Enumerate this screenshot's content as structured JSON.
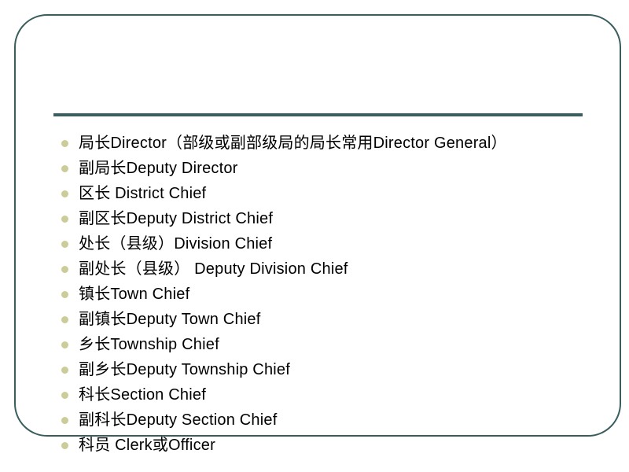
{
  "slide": {
    "title": "",
    "frame": {
      "border_color": "#3a5d5d",
      "corner_radius_px": 42
    },
    "divider": {
      "color": "#3d5e5e"
    },
    "bullet": {
      "marker_icon": "disc-bullet-icon",
      "marker_color": "#cccc99"
    },
    "text_color": "#000000",
    "background_color": "#ffffff"
  },
  "body": {
    "items": [
      {
        "text": "局长Director（部级或副部级局的局长常用Director  General）"
      },
      {
        "text": "副局长Deputy  Director"
      },
      {
        "text": "区长 District Chief"
      },
      {
        "text": "副区长Deputy  District Chief"
      },
      {
        "text": "处长（县级）Division  Chief"
      },
      {
        "text": "副处长（县级） Deputy Division Chief"
      },
      {
        "text": "镇长Town  Chief"
      },
      {
        "text": "副镇长Deputy  Town Chief"
      },
      {
        "text": "乡长Township  Chief"
      },
      {
        "text": "副乡长Deputy  Township  Chief"
      },
      {
        "text": "科长Section Chief"
      },
      {
        "text": "副科长Deputy  Section Chief"
      },
      {
        "text": "科员 Clerk或Officer"
      }
    ]
  }
}
